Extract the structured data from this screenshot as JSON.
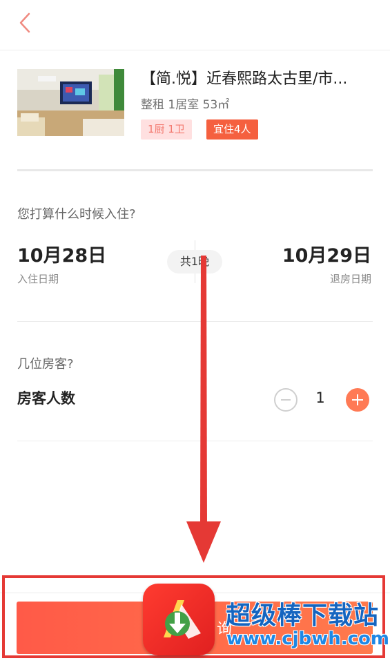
{
  "listing": {
    "title": "【简.悦】近春熙路太古里/市...",
    "subtitle": "整租 1居室 53㎡",
    "tags": [
      "1厨 1卫",
      "宜住4人"
    ]
  },
  "checkin": {
    "question": "您打算什么时候入住?",
    "checkin_date": "10月28日",
    "checkin_label": "入住日期",
    "nights": "共1晚",
    "checkout_date": "10月29日",
    "checkout_label": "退房日期"
  },
  "guests": {
    "question": "几位房客?",
    "label": "房客人数",
    "count": "1"
  },
  "footer": {
    "cta_partial_text": "询"
  },
  "watermark": {
    "name": "超级棒下载站",
    "url": "www.cjbwh.com"
  },
  "colors": {
    "accent": "#ff6a4d",
    "annotation_red": "#e53935",
    "watermark_blue": "#1565c0"
  }
}
